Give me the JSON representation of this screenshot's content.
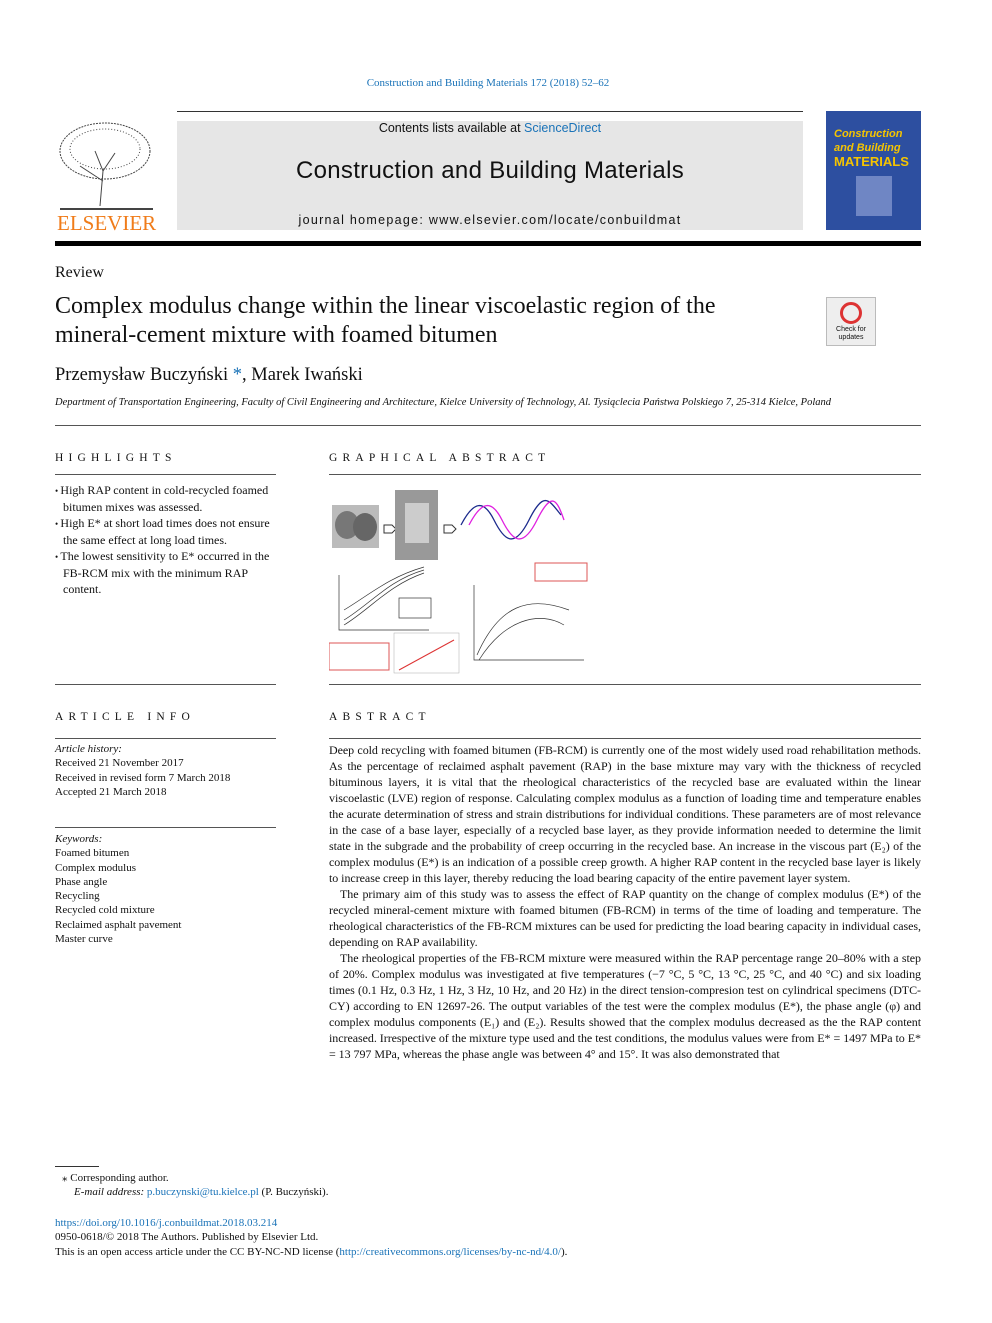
{
  "citation": "Construction and Building Materials 172 (2018) 52–62",
  "header": {
    "contents_prefix": "Contents lists available at ",
    "sciencedirect": "ScienceDirect",
    "journal_title": "Construction and Building Materials",
    "homepage": "journal homepage: www.elsevier.com/locate/conbuildmat",
    "publisher_logo": "ELSEVIER",
    "cover_title": [
      "Construction",
      "and Building",
      "MATERIALS"
    ]
  },
  "article": {
    "type": "Review",
    "title_line1": "Complex modulus change within the linear viscoelastic region of the",
    "title_line2": "mineral-cement mixture with foamed bitumen",
    "check_updates": [
      "Check for",
      "updates"
    ],
    "author1": "Przemysław Buczyński",
    "author1_mark": "*",
    "author_sep": ", ",
    "author2": "Marek Iwański",
    "affiliation": "Department of Transportation Engineering, Faculty of Civil Engineering and Architecture, Kielce University of Technology, Al. Tysiąclecia Państwa Polskiego 7, 25-314 Kielce, Poland"
  },
  "highlights": {
    "heading": "HIGHLIGHTS",
    "items": [
      "High RAP content in cold-recycled foamed bitumen mixes was assessed.",
      "High E* at short load times does not ensure the same effect at long load times.",
      "The lowest sensitivity to E* occurred in the FB-RCM mix with the minimum RAP content."
    ]
  },
  "graphical_abstract": {
    "heading": "GRAPHICAL ABSTRACT"
  },
  "article_info": {
    "heading": "ARTICLE INFO",
    "history_label": "Article history:",
    "history": [
      "Received 21 November 2017",
      "Received in revised form 7 March 2018",
      "Accepted 21 March 2018"
    ],
    "keywords_label": "Keywords:",
    "keywords": [
      "Foamed bitumen",
      "Complex modulus",
      "Phase angle",
      "Recycling",
      "Recycled cold mixture",
      "Reclaimed asphalt pavement",
      "Master curve"
    ]
  },
  "abstract": {
    "heading": "ABSTRACT",
    "paragraphs": [
      "Deep cold recycling with foamed bitumen (FB-RCM) is currently one of the most widely used road rehabilitation methods. As the percentage of reclaimed asphalt pavement (RAP) in the base mixture may vary with the thickness of recycled bituminous layers, it is vital that the rheological characteristics of the recycled base are evaluated within the linear viscoelastic (LVE) region of response. Calculating complex modulus as a function of loading time and temperature enables the acurate determination of stress and strain distributions for individual conditions. These parameters are of most relevance in the case of a base layer, especially of a recycled base layer, as they provide information needed to determine the limit state in the subgrade and the probability of creep occurring in the recycled base. An increase in the viscous part (E₂) of the complex modulus (E*) is an indication of a possible creep growth. A higher RAP content in the recycled base layer is likely to increase creep in this layer, thereby reducing the load bearing capacity of the entire pavement layer system.",
      "The primary aim of this study was to assess the effect of RAP quantity on the change of complex modulus (E*) of the recycled mineral-cement mixture with foamed bitumen (FB-RCM) in terms of the time of loading and temperature. The rheological characteristics of the FB-RCM mixtures can be used for predicting the load bearing capacity in individual cases, depending on RAP availability.",
      "The rheological properties of the FB-RCM mixture were measured within the RAP percentage range 20–80% with a step of 20%. Complex modulus was investigated at five temperatures (−7 °C, 5 °C, 13 °C, 25 °C, and 40 °C) and six loading times (0.1 Hz, 0.3 Hz, 1 Hz, 3 Hz, 10 Hz, and 20 Hz) in the direct tension-compresion test on cylindrical specimens (DTC-CY) according to EN 12697-26. The output variables of the test were the complex modulus (E*), the phase angle (φ) and complex modulus components (E₁) and (E₂). Results showed that the complex modulus decreased as the the RAP content increased. Irrespective of the mixture type used and the test conditions, the modulus values were from E* = 1497 MPa to E* = 13 797 MPa, whereas the phase angle was between 4° and 15°. It was also demonstrated that"
    ]
  },
  "footnote": {
    "mark": "⁎",
    "corresponding": "Corresponding author.",
    "email_label": "E-mail address: ",
    "email": "p.buczynski@tu.kielce.pl",
    "email_suffix": " (P. Buczyński)."
  },
  "footer": {
    "doi": "https://doi.org/10.1016/j.conbuildmat.2018.03.214",
    "issn": "0950-0618/© 2018 The Authors. Published by Elsevier Ltd.",
    "license_prefix": "This is an open access article under the CC BY-NC-ND license (",
    "license_url": "http://creativecommons.org/licenses/by-nc-nd/4.0/",
    "license_suffix": ")."
  },
  "colors": {
    "link": "#1a73b8",
    "elsevier_orange": "#f07c1a",
    "cover_blue": "#2d4fa0",
    "header_gray": "#e6e6e6"
  }
}
